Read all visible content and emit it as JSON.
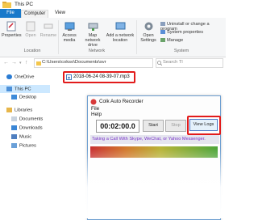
{
  "window": {
    "title": "This PC"
  },
  "ribbon": {
    "tabs": [
      "File",
      "Computer",
      "View"
    ],
    "buttons": {
      "properties": "Properties",
      "open": "Open",
      "rename": "Rename",
      "access_media": "Access media",
      "map_network_drive": "Map network drive",
      "add_network_location": "Add a network location",
      "open_settings": "Open Settings",
      "uninstall": "Uninstall or change a program",
      "system_properties": "System properties",
      "manage": "Manage"
    },
    "groups": {
      "location": "Location",
      "network": "Network",
      "system": "System"
    }
  },
  "address": {
    "path": "C:\\Users\\cokso\\Documents\\svr",
    "search_placeholder": "Search Tl"
  },
  "nav": {
    "items": [
      "OneDrive",
      "This PC",
      "Desktop",
      "Libraries",
      "Documents",
      "Downloads",
      "Music",
      "Pictures"
    ]
  },
  "file": {
    "name": "2018-06-24 08-39-07.mp3"
  },
  "recorder": {
    "title": "Colk Auto Recorder",
    "menu": [
      "File",
      "Help"
    ],
    "time": "00:02:00.0",
    "start_label": "Start",
    "stop_label": "Stop",
    "view_logs_label": "View Logs",
    "caption": "Taking a Call With Skype, WeChat, or Yahoo Messenger."
  },
  "colors": {
    "accent": "#1979ca",
    "highlight": "#e21b1b",
    "caption_text": "#7a35c9"
  }
}
